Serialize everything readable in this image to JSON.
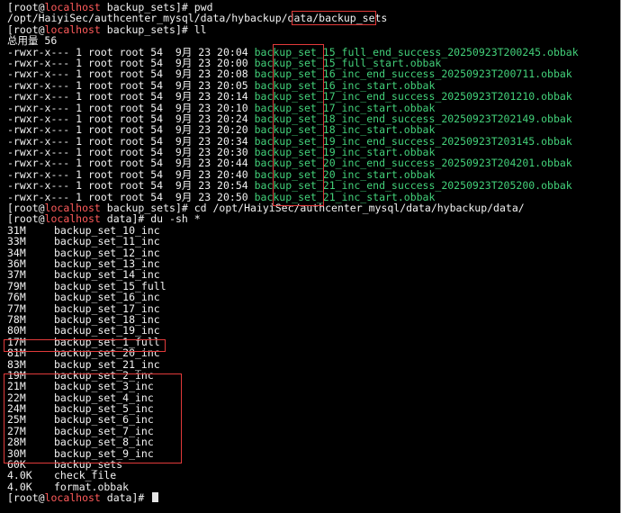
{
  "prompt": {
    "open": "[root@",
    "host": "localhost",
    "close_bs": " backup_sets]# ",
    "close_data": " data]# "
  },
  "lines": [
    {
      "type": "prompt",
      "dir": "backup_sets",
      "cmd": "pwd"
    },
    {
      "type": "text",
      "text": "/opt/HaiyiSec/authcenter_mysql/data/hybackup/data/backup_sets"
    },
    {
      "type": "prompt",
      "dir": "backup_sets",
      "cmd": "ll"
    },
    {
      "type": "text",
      "text": "总用量 56"
    }
  ],
  "ll_rows": [
    {
      "perm": "-rwxr-x---",
      "links": "1",
      "owner": "root",
      "group": "root",
      "size": "54",
      "month": "9月",
      "day": "23",
      "time": "20:04",
      "name": "backup_set_15_full_end_success_20250923T200245.obbak"
    },
    {
      "perm": "-rwxr-x---",
      "links": "1",
      "owner": "root",
      "group": "root",
      "size": "54",
      "month": "9月",
      "day": "23",
      "time": "20:00",
      "name": "backup_set_15_full_start.obbak"
    },
    {
      "perm": "-rwxr-x---",
      "links": "1",
      "owner": "root",
      "group": "root",
      "size": "54",
      "month": "9月",
      "day": "23",
      "time": "20:08",
      "name": "backup_set_16_inc_end_success_20250923T200711.obbak"
    },
    {
      "perm": "-rwxr-x---",
      "links": "1",
      "owner": "root",
      "group": "root",
      "size": "54",
      "month": "9月",
      "day": "23",
      "time": "20:05",
      "name": "backup_set_16_inc_start.obbak"
    },
    {
      "perm": "-rwxr-x---",
      "links": "1",
      "owner": "root",
      "group": "root",
      "size": "54",
      "month": "9月",
      "day": "23",
      "time": "20:14",
      "name": "backup_set_17_inc_end_success_20250923T201210.obbak"
    },
    {
      "perm": "-rwxr-x---",
      "links": "1",
      "owner": "root",
      "group": "root",
      "size": "54",
      "month": "9月",
      "day": "23",
      "time": "20:10",
      "name": "backup_set_17_inc_start.obbak"
    },
    {
      "perm": "-rwxr-x---",
      "links": "1",
      "owner": "root",
      "group": "root",
      "size": "54",
      "month": "9月",
      "day": "23",
      "time": "20:24",
      "name": "backup_set_18_inc_end_success_20250923T202149.obbak"
    },
    {
      "perm": "-rwxr-x---",
      "links": "1",
      "owner": "root",
      "group": "root",
      "size": "54",
      "month": "9月",
      "day": "23",
      "time": "20:20",
      "name": "backup_set_18_inc_start.obbak"
    },
    {
      "perm": "-rwxr-x---",
      "links": "1",
      "owner": "root",
      "group": "root",
      "size": "54",
      "month": "9月",
      "day": "23",
      "time": "20:34",
      "name": "backup_set_19_inc_end_success_20250923T203145.obbak"
    },
    {
      "perm": "-rwxr-x---",
      "links": "1",
      "owner": "root",
      "group": "root",
      "size": "54",
      "month": "9月",
      "day": "23",
      "time": "20:30",
      "name": "backup_set_19_inc_start.obbak"
    },
    {
      "perm": "-rwxr-x---",
      "links": "1",
      "owner": "root",
      "group": "root",
      "size": "54",
      "month": "9月",
      "day": "23",
      "time": "20:44",
      "name": "backup_set_20_inc_end_success_20250923T204201.obbak"
    },
    {
      "perm": "-rwxr-x---",
      "links": "1",
      "owner": "root",
      "group": "root",
      "size": "54",
      "month": "9月",
      "day": "23",
      "time": "20:40",
      "name": "backup_set_20_inc_start.obbak"
    },
    {
      "perm": "-rwxr-x---",
      "links": "1",
      "owner": "root",
      "group": "root",
      "size": "54",
      "month": "9月",
      "day": "23",
      "time": "20:54",
      "name": "backup_set_21_inc_end_success_20250923T205200.obbak"
    },
    {
      "perm": "-rwxr-x---",
      "links": "1",
      "owner": "root",
      "group": "root",
      "size": "54",
      "month": "9月",
      "day": "23",
      "time": "20:50",
      "name": "backup_set_21_inc_start.obbak"
    }
  ],
  "cd_line": {
    "dir": "backup_sets",
    "cmd": "cd /opt/HaiyiSec/authcenter_mysql/data/hybackup/data/"
  },
  "du_line": {
    "dir": "data",
    "cmd": "du -sh *"
  },
  "du_rows": [
    {
      "size": "31M",
      "name": "backup_set_10_inc"
    },
    {
      "size": "33M",
      "name": "backup_set_11_inc"
    },
    {
      "size": "34M",
      "name": "backup_set_12_inc"
    },
    {
      "size": "36M",
      "name": "backup_set_13_inc"
    },
    {
      "size": "37M",
      "name": "backup_set_14_inc"
    },
    {
      "size": "79M",
      "name": "backup_set_15_full"
    },
    {
      "size": "76M",
      "name": "backup_set_16_inc"
    },
    {
      "size": "77M",
      "name": "backup_set_17_inc"
    },
    {
      "size": "78M",
      "name": "backup_set_18_inc"
    },
    {
      "size": "80M",
      "name": "backup_set_19_inc"
    },
    {
      "size": "17M",
      "name": "backup_set_1_full"
    },
    {
      "size": "81M",
      "name": "backup_set_20_inc"
    },
    {
      "size": "83M",
      "name": "backup_set_21_inc"
    },
    {
      "size": "19M",
      "name": "backup_set_2_inc"
    },
    {
      "size": "21M",
      "name": "backup_set_3_inc"
    },
    {
      "size": "22M",
      "name": "backup_set_4_inc"
    },
    {
      "size": "24M",
      "name": "backup_set_5_inc"
    },
    {
      "size": "25M",
      "name": "backup_set_6_inc"
    },
    {
      "size": "27M",
      "name": "backup_set_7_inc"
    },
    {
      "size": "28M",
      "name": "backup_set_8_inc"
    },
    {
      "size": "30M",
      "name": "backup_set_9_inc"
    },
    {
      "size": "60K",
      "name": "backup_sets"
    },
    {
      "size": "4.0K",
      "name": "check_file"
    },
    {
      "size": "4.0K",
      "name": "format.obbak"
    }
  ],
  "final_prompt": {
    "dir": "data",
    "cmd": ""
  },
  "colors": {
    "background": "#000000",
    "text": "#f2f2f2",
    "host": "#ff5b5b",
    "file": "#43d17a",
    "annotation": "#e23a3a"
  }
}
